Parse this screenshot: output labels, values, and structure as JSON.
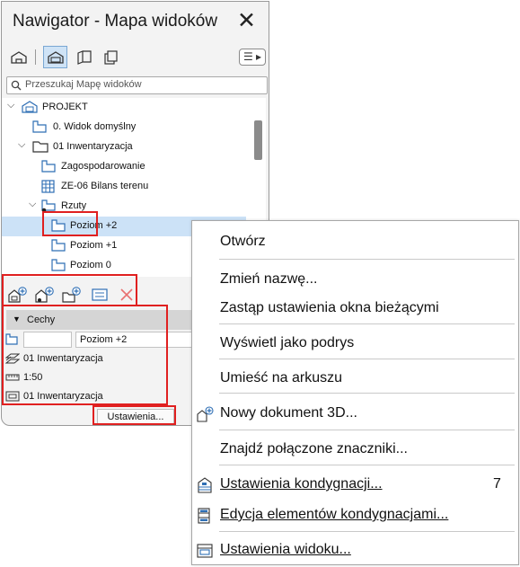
{
  "window": {
    "title": "Nawigator - Mapa widoków"
  },
  "toolbar": {
    "icons": [
      "project-map-icon",
      "view-map-icon",
      "layout-book-icon",
      "publisher-sets-icon"
    ],
    "menu_label": "☰ ▸"
  },
  "search": {
    "placeholder": "Przeszukaj Mapę widoków"
  },
  "tree": {
    "items": [
      {
        "label": "PROJEKT"
      },
      {
        "label": "0. Widok domyślny"
      },
      {
        "label": "01 Inwentaryzacja"
      },
      {
        "label": "Zagospodarowanie"
      },
      {
        "label": "ZE-06 Bilans terenu"
      },
      {
        "label": "Rzuty"
      },
      {
        "label": "Poziom +2"
      },
      {
        "label": "Poziom +1"
      },
      {
        "label": "Poziom 0"
      }
    ]
  },
  "properties": {
    "section_label": "Cechy",
    "name_field": "Poziom +2",
    "layer_combo": "01 Inwentaryzacja",
    "scale": "1:50",
    "model_view": "01 Inwentaryzacja",
    "settings_button": "Ustawienia..."
  },
  "context_menu": {
    "items": [
      {
        "label": "Otwórz"
      },
      {
        "label": "Zmień nazwę..."
      },
      {
        "label": "Zastąp ustawienia okna bieżącymi"
      },
      {
        "label": "Wyświetl jako podrys"
      },
      {
        "label": "Umieść na arkuszu"
      },
      {
        "label": "Nowy dokument 3D..."
      },
      {
        "label": "Znajdź połączone znaczniki..."
      },
      {
        "label": "Ustawienia kondygnacji...",
        "shortcut": "7"
      },
      {
        "label": "Edycja elementów kondygnacjami..."
      },
      {
        "label": "Ustawienia widoku..."
      }
    ]
  },
  "colors": {
    "highlight_red": "#e02020",
    "selection_blue": "#cce2f7",
    "icon_blue": "#2f6fb5"
  }
}
